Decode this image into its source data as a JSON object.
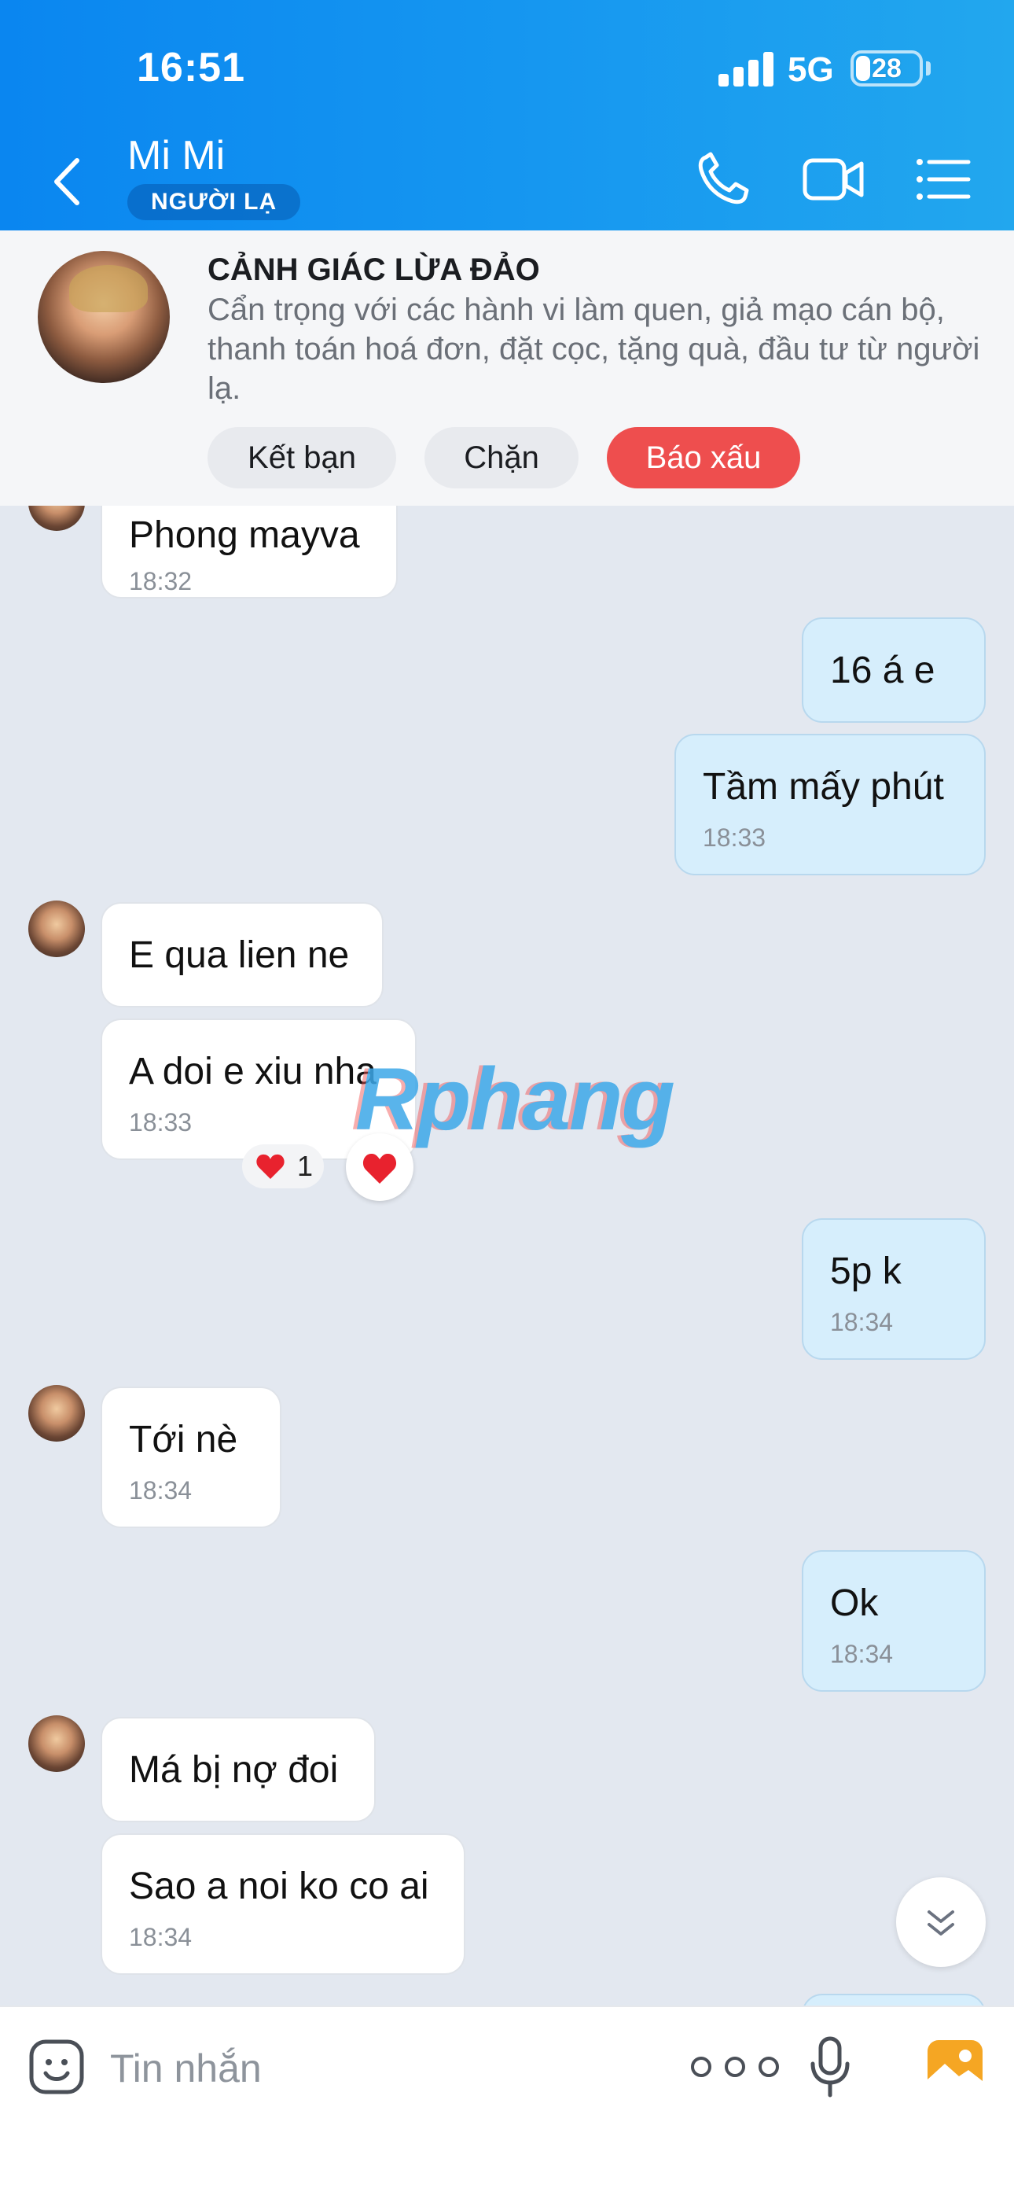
{
  "status_bar": {
    "time": "16:51",
    "network": "5G",
    "battery": "28",
    "battery_level": 0.28
  },
  "header": {
    "name": "Mi Mi",
    "tag": "NGƯỜI LẠ",
    "icons": [
      "back-chevron-icon",
      "phone-icon",
      "video-camera-icon",
      "list-menu-icon"
    ]
  },
  "warning": {
    "title": "CẢNH GIÁC LỪA ĐẢO",
    "text": "Cẩn trọng với các hành vi làm quen, giả mạo cán bộ, thanh toán hoá đơn, đặt cọc, tặng quà, đầu tư từ người lạ.",
    "buttons": {
      "add_friend": "Kết bạn",
      "block": "Chặn",
      "report": "Báo xấu"
    },
    "colors": {
      "report": "#ee4e4e"
    }
  },
  "messages": [
    {
      "dir": "in",
      "text": "Phong mayva",
      "time": "18:32"
    },
    {
      "dir": "out",
      "text": "16 á e",
      "time": ""
    },
    {
      "dir": "out",
      "text": "Tầm mấy phút",
      "time": "18:33"
    },
    {
      "dir": "in",
      "text": "E qua lien ne",
      "time": ""
    },
    {
      "dir": "in",
      "text": "A doi e xiu nha",
      "time": "18:33"
    },
    {
      "dir": "out",
      "text": "5p k",
      "time": "18:34"
    },
    {
      "dir": "in",
      "text": "Tới nè",
      "time": "18:34"
    },
    {
      "dir": "out",
      "text": "Ok",
      "time": "18:34"
    },
    {
      "dir": "in",
      "text": "Má bị nợ đoi",
      "time": ""
    },
    {
      "dir": "in",
      "text": "Sao a noi ko co ai",
      "time": "18:34"
    }
  ],
  "reaction": {
    "emoji": "heart",
    "count": "1"
  },
  "watermark": "Rphang",
  "input": {
    "placeholder": "Tin nhắn"
  },
  "colors": {
    "header_start": "#0a86f0",
    "header_end": "#22a7ee",
    "outgoing_bubble": "#d6eefc",
    "chat_bg": "#e3e8f0"
  }
}
